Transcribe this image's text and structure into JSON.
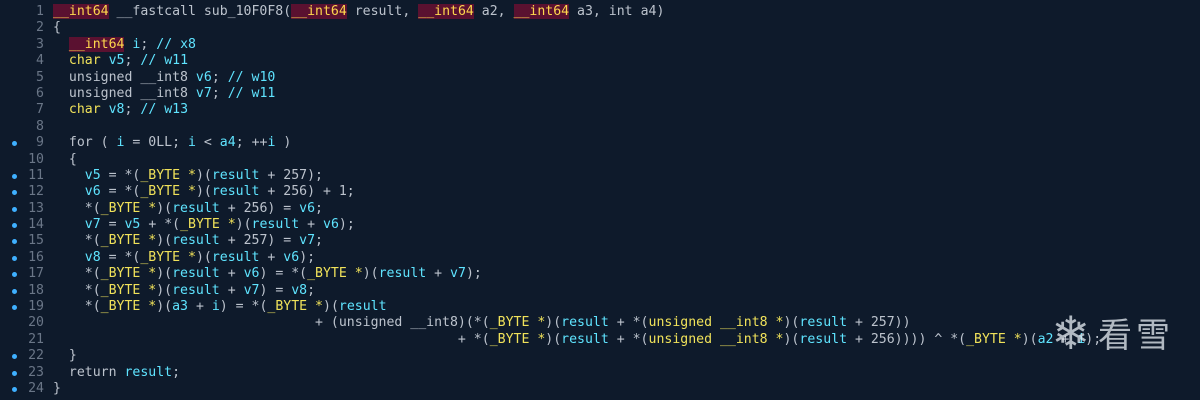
{
  "editor": {
    "lines": [
      {
        "num": "1",
        "bp": false,
        "tokens": [
          {
            "t": "__int64",
            "c": "hl"
          },
          {
            "t": " __fastcall sub_10F0F8(",
            "c": "normal"
          },
          {
            "t": "__int64",
            "c": "hl"
          },
          {
            "t": " result, ",
            "c": "normal"
          },
          {
            "t": "__int64",
            "c": "hl"
          },
          {
            "t": " a2, ",
            "c": "normal"
          },
          {
            "t": "__int64",
            "c": "hl"
          },
          {
            "t": " a3, int a4)",
            "c": "normal"
          }
        ]
      },
      {
        "num": "2",
        "bp": false,
        "tokens": [
          {
            "t": "{",
            "c": "normal"
          }
        ]
      },
      {
        "num": "3",
        "bp": false,
        "tokens": [
          {
            "t": "  ",
            "c": "normal"
          },
          {
            "t": "__int64",
            "c": "hl"
          },
          {
            "t": " ",
            "c": "normal"
          },
          {
            "t": "i",
            "c": "var"
          },
          {
            "t": "; ",
            "c": "normal"
          },
          {
            "t": "// x8",
            "c": "comment"
          }
        ]
      },
      {
        "num": "4",
        "bp": false,
        "tokens": [
          {
            "t": "  ",
            "c": "normal"
          },
          {
            "t": "char",
            "c": "type"
          },
          {
            "t": " ",
            "c": "normal"
          },
          {
            "t": "v5",
            "c": "var"
          },
          {
            "t": "; ",
            "c": "normal"
          },
          {
            "t": "// w11",
            "c": "comment"
          }
        ]
      },
      {
        "num": "5",
        "bp": false,
        "tokens": [
          {
            "t": "  unsigned __int8 ",
            "c": "normal"
          },
          {
            "t": "v6",
            "c": "var"
          },
          {
            "t": "; ",
            "c": "normal"
          },
          {
            "t": "// w10",
            "c": "comment"
          }
        ]
      },
      {
        "num": "6",
        "bp": false,
        "tokens": [
          {
            "t": "  unsigned __int8 ",
            "c": "normal"
          },
          {
            "t": "v7",
            "c": "var"
          },
          {
            "t": "; ",
            "c": "normal"
          },
          {
            "t": "// w11",
            "c": "comment"
          }
        ]
      },
      {
        "num": "7",
        "bp": false,
        "tokens": [
          {
            "t": "  ",
            "c": "normal"
          },
          {
            "t": "char",
            "c": "type"
          },
          {
            "t": " ",
            "c": "normal"
          },
          {
            "t": "v8",
            "c": "var"
          },
          {
            "t": "; ",
            "c": "normal"
          },
          {
            "t": "// w13",
            "c": "comment"
          }
        ]
      },
      {
        "num": "8",
        "bp": false,
        "tokens": [
          {
            "t": "",
            "c": "normal"
          }
        ]
      },
      {
        "num": "9",
        "bp": true,
        "tokens": [
          {
            "t": "  for ( ",
            "c": "normal"
          },
          {
            "t": "i",
            "c": "var"
          },
          {
            "t": " = 0LL; ",
            "c": "normal"
          },
          {
            "t": "i",
            "c": "var"
          },
          {
            "t": " < ",
            "c": "normal"
          },
          {
            "t": "a4",
            "c": "var"
          },
          {
            "t": "; ++",
            "c": "normal"
          },
          {
            "t": "i",
            "c": "var"
          },
          {
            "t": " )",
            "c": "normal"
          }
        ]
      },
      {
        "num": "10",
        "bp": false,
        "tokens": [
          {
            "t": "  {",
            "c": "normal"
          }
        ]
      },
      {
        "num": "11",
        "bp": true,
        "tokens": [
          {
            "t": "    ",
            "c": "normal"
          },
          {
            "t": "v5",
            "c": "var"
          },
          {
            "t": " = *(",
            "c": "normal"
          },
          {
            "t": "_BYTE *",
            "c": "type"
          },
          {
            "t": ")(",
            "c": "normal"
          },
          {
            "t": "result",
            "c": "var"
          },
          {
            "t": " + 257);",
            "c": "normal"
          }
        ]
      },
      {
        "num": "12",
        "bp": true,
        "tokens": [
          {
            "t": "    ",
            "c": "normal"
          },
          {
            "t": "v6",
            "c": "var"
          },
          {
            "t": " = *(",
            "c": "normal"
          },
          {
            "t": "_BYTE *",
            "c": "type"
          },
          {
            "t": ")(",
            "c": "normal"
          },
          {
            "t": "result",
            "c": "var"
          },
          {
            "t": " + 256) + 1;",
            "c": "normal"
          }
        ]
      },
      {
        "num": "13",
        "bp": true,
        "tokens": [
          {
            "t": "    *(",
            "c": "normal"
          },
          {
            "t": "_BYTE *",
            "c": "type"
          },
          {
            "t": ")(",
            "c": "normal"
          },
          {
            "t": "result",
            "c": "var"
          },
          {
            "t": " + 256) = ",
            "c": "normal"
          },
          {
            "t": "v6",
            "c": "var"
          },
          {
            "t": ";",
            "c": "normal"
          }
        ]
      },
      {
        "num": "14",
        "bp": true,
        "tokens": [
          {
            "t": "    ",
            "c": "normal"
          },
          {
            "t": "v7",
            "c": "var"
          },
          {
            "t": " = ",
            "c": "normal"
          },
          {
            "t": "v5",
            "c": "var"
          },
          {
            "t": " + *(",
            "c": "normal"
          },
          {
            "t": "_BYTE *",
            "c": "type"
          },
          {
            "t": ")(",
            "c": "normal"
          },
          {
            "t": "result",
            "c": "var"
          },
          {
            "t": " + ",
            "c": "normal"
          },
          {
            "t": "v6",
            "c": "var"
          },
          {
            "t": ");",
            "c": "normal"
          }
        ]
      },
      {
        "num": "15",
        "bp": true,
        "tokens": [
          {
            "t": "    *(",
            "c": "normal"
          },
          {
            "t": "_BYTE *",
            "c": "type"
          },
          {
            "t": ")(",
            "c": "normal"
          },
          {
            "t": "result",
            "c": "var"
          },
          {
            "t": " + 257) = ",
            "c": "normal"
          },
          {
            "t": "v7",
            "c": "var"
          },
          {
            "t": ";",
            "c": "normal"
          }
        ]
      },
      {
        "num": "16",
        "bp": true,
        "tokens": [
          {
            "t": "    ",
            "c": "normal"
          },
          {
            "t": "v8",
            "c": "var"
          },
          {
            "t": " = *(",
            "c": "normal"
          },
          {
            "t": "_BYTE *",
            "c": "type"
          },
          {
            "t": ")(",
            "c": "normal"
          },
          {
            "t": "result",
            "c": "var"
          },
          {
            "t": " + ",
            "c": "normal"
          },
          {
            "t": "v6",
            "c": "var"
          },
          {
            "t": ");",
            "c": "normal"
          }
        ]
      },
      {
        "num": "17",
        "bp": true,
        "tokens": [
          {
            "t": "    *(",
            "c": "normal"
          },
          {
            "t": "_BYTE *",
            "c": "type"
          },
          {
            "t": ")(",
            "c": "normal"
          },
          {
            "t": "result",
            "c": "var"
          },
          {
            "t": " + ",
            "c": "normal"
          },
          {
            "t": "v6",
            "c": "var"
          },
          {
            "t": ") = *(",
            "c": "normal"
          },
          {
            "t": "_BYTE *",
            "c": "type"
          },
          {
            "t": ")(",
            "c": "normal"
          },
          {
            "t": "result",
            "c": "var"
          },
          {
            "t": " + ",
            "c": "normal"
          },
          {
            "t": "v7",
            "c": "var"
          },
          {
            "t": ");",
            "c": "normal"
          }
        ]
      },
      {
        "num": "18",
        "bp": true,
        "tokens": [
          {
            "t": "    *(",
            "c": "normal"
          },
          {
            "t": "_BYTE *",
            "c": "type"
          },
          {
            "t": ")(",
            "c": "normal"
          },
          {
            "t": "result",
            "c": "var"
          },
          {
            "t": " + ",
            "c": "normal"
          },
          {
            "t": "v7",
            "c": "var"
          },
          {
            "t": ") = ",
            "c": "normal"
          },
          {
            "t": "v8",
            "c": "var"
          },
          {
            "t": ";",
            "c": "normal"
          }
        ]
      },
      {
        "num": "19",
        "bp": true,
        "tokens": [
          {
            "t": "    *(",
            "c": "normal"
          },
          {
            "t": "_BYTE *",
            "c": "type"
          },
          {
            "t": ")(",
            "c": "normal"
          },
          {
            "t": "a3",
            "c": "var"
          },
          {
            "t": " + ",
            "c": "normal"
          },
          {
            "t": "i",
            "c": "var"
          },
          {
            "t": ") = *(",
            "c": "normal"
          },
          {
            "t": "_BYTE *",
            "c": "type"
          },
          {
            "t": ")(",
            "c": "normal"
          },
          {
            "t": "result",
            "c": "var"
          }
        ]
      },
      {
        "num": "20",
        "bp": false,
        "tokens": [
          {
            "t": "                                 + (unsigned __int8)(*(",
            "c": "normal"
          },
          {
            "t": "_BYTE *",
            "c": "type"
          },
          {
            "t": ")(",
            "c": "normal"
          },
          {
            "t": "result",
            "c": "var"
          },
          {
            "t": " + *(",
            "c": "normal"
          },
          {
            "t": "unsigned __int8 *",
            "c": "type"
          },
          {
            "t": ")(",
            "c": "normal"
          },
          {
            "t": "result",
            "c": "var"
          },
          {
            "t": " + 257))",
            "c": "normal"
          }
        ]
      },
      {
        "num": "21",
        "bp": false,
        "tokens": [
          {
            "t": "                                                   + *(",
            "c": "normal"
          },
          {
            "t": "_BYTE *",
            "c": "type"
          },
          {
            "t": ")(",
            "c": "normal"
          },
          {
            "t": "result",
            "c": "var"
          },
          {
            "t": " + *(",
            "c": "normal"
          },
          {
            "t": "unsigned __int8 *",
            "c": "type"
          },
          {
            "t": ")(",
            "c": "normal"
          },
          {
            "t": "result",
            "c": "var"
          },
          {
            "t": " + 256)))) ^ *(",
            "c": "normal"
          },
          {
            "t": "_BYTE *",
            "c": "type"
          },
          {
            "t": ")(",
            "c": "normal"
          },
          {
            "t": "a2",
            "c": "var"
          },
          {
            "t": " + ",
            "c": "normal"
          },
          {
            "t": "i",
            "c": "var"
          },
          {
            "t": ");",
            "c": "normal"
          }
        ]
      },
      {
        "num": "22",
        "bp": true,
        "tokens": [
          {
            "t": "  }",
            "c": "normal"
          }
        ]
      },
      {
        "num": "23",
        "bp": true,
        "tokens": [
          {
            "t": "  return ",
            "c": "normal"
          },
          {
            "t": "result",
            "c": "var"
          },
          {
            "t": ";",
            "c": "normal"
          }
        ]
      },
      {
        "num": "24",
        "bp": true,
        "tokens": [
          {
            "t": "}",
            "c": "normal"
          }
        ]
      }
    ]
  },
  "watermark": {
    "icon": "snowflake-icon",
    "text": "看雪"
  },
  "colors": {
    "background": "#0e1a2b",
    "normal": "#bcc3cd",
    "variable": "#5fe4ff",
    "type": "#f0e25a",
    "highlight_fg": "#ffd84d",
    "highlight_bg": "#5a1130",
    "line_number": "#6a7687",
    "breakpoint_dot": "#3fb0ff"
  }
}
